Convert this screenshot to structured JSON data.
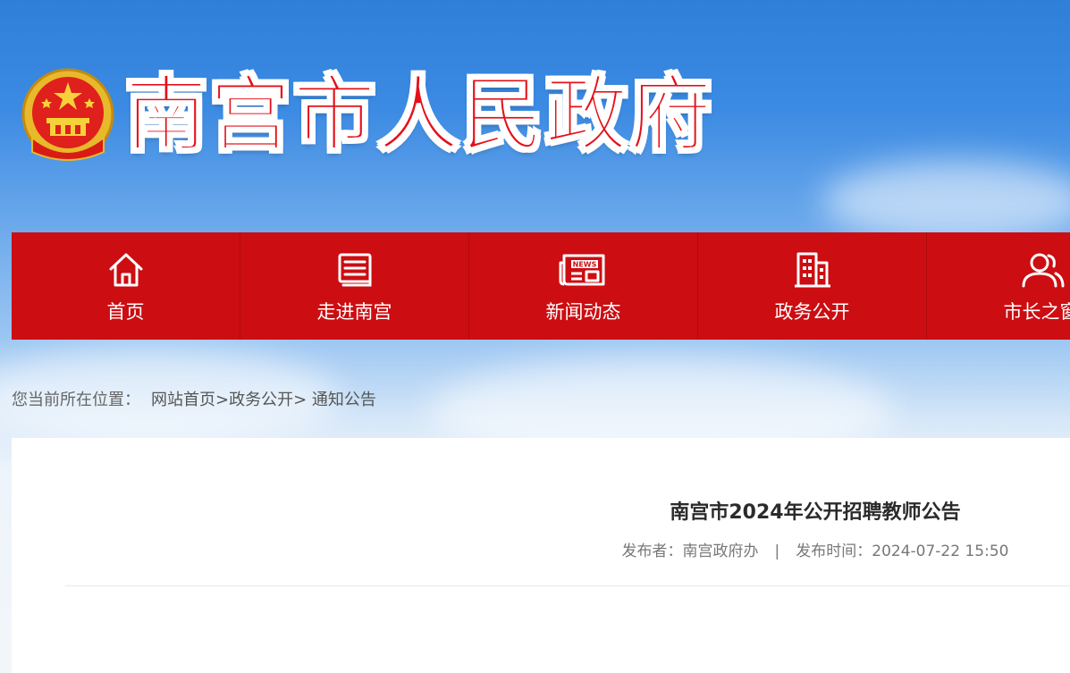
{
  "header": {
    "site_title": "南宫市人民政府"
  },
  "nav": {
    "items": [
      {
        "label": "首页",
        "icon": "home-icon"
      },
      {
        "label": "走进南宫",
        "icon": "document-list-icon"
      },
      {
        "label": "新闻动态",
        "icon": "newspaper-icon"
      },
      {
        "label": "政务公开",
        "icon": "building-icon"
      },
      {
        "label": "市长之窗",
        "icon": "users-icon"
      }
    ]
  },
  "breadcrumb": {
    "prefix": "您当前所在位置：",
    "home": "网站首页",
    "sep1": ">",
    "section": "政务公开",
    "sep2": ">",
    "current": "通知公告"
  },
  "article": {
    "title": "南宫市2024年公开招聘教师公告",
    "publisher_label": "发布者：南宫政府办",
    "separator": "|",
    "time_label": "发布时间：2024-07-22 15:50"
  },
  "colors": {
    "nav_red": "#cc0d12",
    "title_red": "#e3101a",
    "sky_blue": "#3b8ae3"
  }
}
